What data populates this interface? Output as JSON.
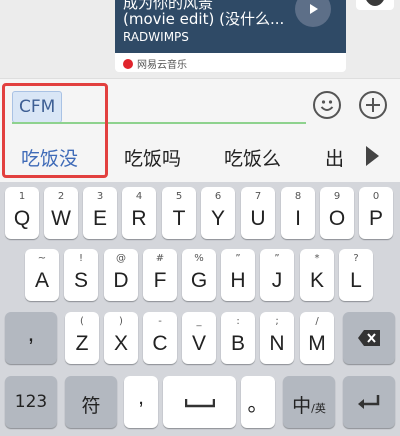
{
  "card": {
    "title_top": "成为你的风景",
    "title": "(movie edit) (没什么...",
    "artist": "RADWIMPS",
    "source": "网易云音乐"
  },
  "input": {
    "text": "CFM"
  },
  "candidates": [
    "吃饭没",
    "吃饭吗",
    "吃饭么",
    "出"
  ],
  "keyboard": {
    "row1": [
      {
        "key": "Q",
        "hint": "1"
      },
      {
        "key": "W",
        "hint": "2"
      },
      {
        "key": "E",
        "hint": "3"
      },
      {
        "key": "R",
        "hint": "4"
      },
      {
        "key": "T",
        "hint": "5"
      },
      {
        "key": "Y",
        "hint": "6"
      },
      {
        "key": "U",
        "hint": "7"
      },
      {
        "key": "I",
        "hint": "8"
      },
      {
        "key": "O",
        "hint": "9"
      },
      {
        "key": "P",
        "hint": "0"
      }
    ],
    "row2": [
      {
        "key": "A",
        "hint": "~"
      },
      {
        "key": "S",
        "hint": "!"
      },
      {
        "key": "D",
        "hint": "@"
      },
      {
        "key": "F",
        "hint": "#"
      },
      {
        "key": "G",
        "hint": "%"
      },
      {
        "key": "H",
        "hint": "”"
      },
      {
        "key": "J",
        "hint": "”"
      },
      {
        "key": "K",
        "hint": "*"
      },
      {
        "key": "L",
        "hint": "?"
      }
    ],
    "row3_left": ",",
    "row3": [
      {
        "key": "Z",
        "hint": "("
      },
      {
        "key": "X",
        "hint": ")"
      },
      {
        "key": "C",
        "hint": "-"
      },
      {
        "key": "V",
        "hint": "_"
      },
      {
        "key": "B",
        "hint": ":"
      },
      {
        "key": "N",
        "hint": ";"
      },
      {
        "key": "M",
        "hint": "/"
      }
    ],
    "num": "123",
    "symbol": "符",
    "comma": ",",
    "period": "。",
    "lang": "中",
    "lang_sub": "/英"
  }
}
